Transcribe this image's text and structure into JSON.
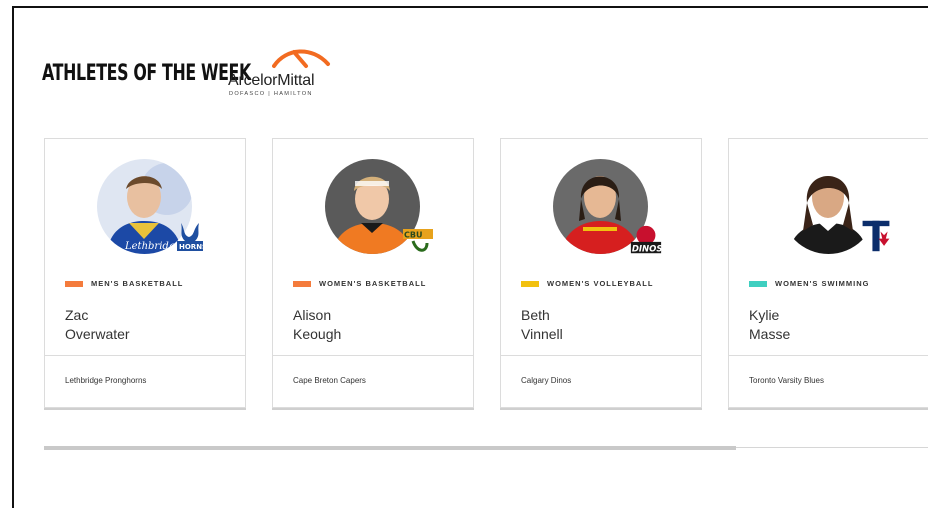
{
  "header": {
    "title": "ATHLETES OF THE WEEK",
    "sponsor_name": "ArcelorMittal",
    "sponsor_sub": "DOFASCO | HAMILTON",
    "sponsor_color": "#f26b21"
  },
  "cards": [
    {
      "sport": "MEN'S BASKETBALL",
      "sport_color": "#f47b3c",
      "first": "Zac",
      "last": "Overwater",
      "team": "Lethbridge Pronghorns",
      "team_color": "#1f4fa0"
    },
    {
      "sport": "WOMEN'S BASKETBALL",
      "sport_color": "#f47b3c",
      "first": "Alison",
      "last": "Keough",
      "team": "Cape Breton Capers",
      "team_color": "#e76e1c"
    },
    {
      "sport": "WOMEN'S VOLLEYBALL",
      "sport_color": "#f2c10f",
      "first": "Beth",
      "last": "Vinnell",
      "team": "Calgary Dinos",
      "team_color": "#c8102e"
    },
    {
      "sport": "WOMEN'S SWIMMING",
      "sport_color": "#3fcfc0",
      "first": "Kylie",
      "last": "Masse",
      "team": "Toronto Varsity Blues",
      "team_color": "#0b2d6b"
    }
  ]
}
